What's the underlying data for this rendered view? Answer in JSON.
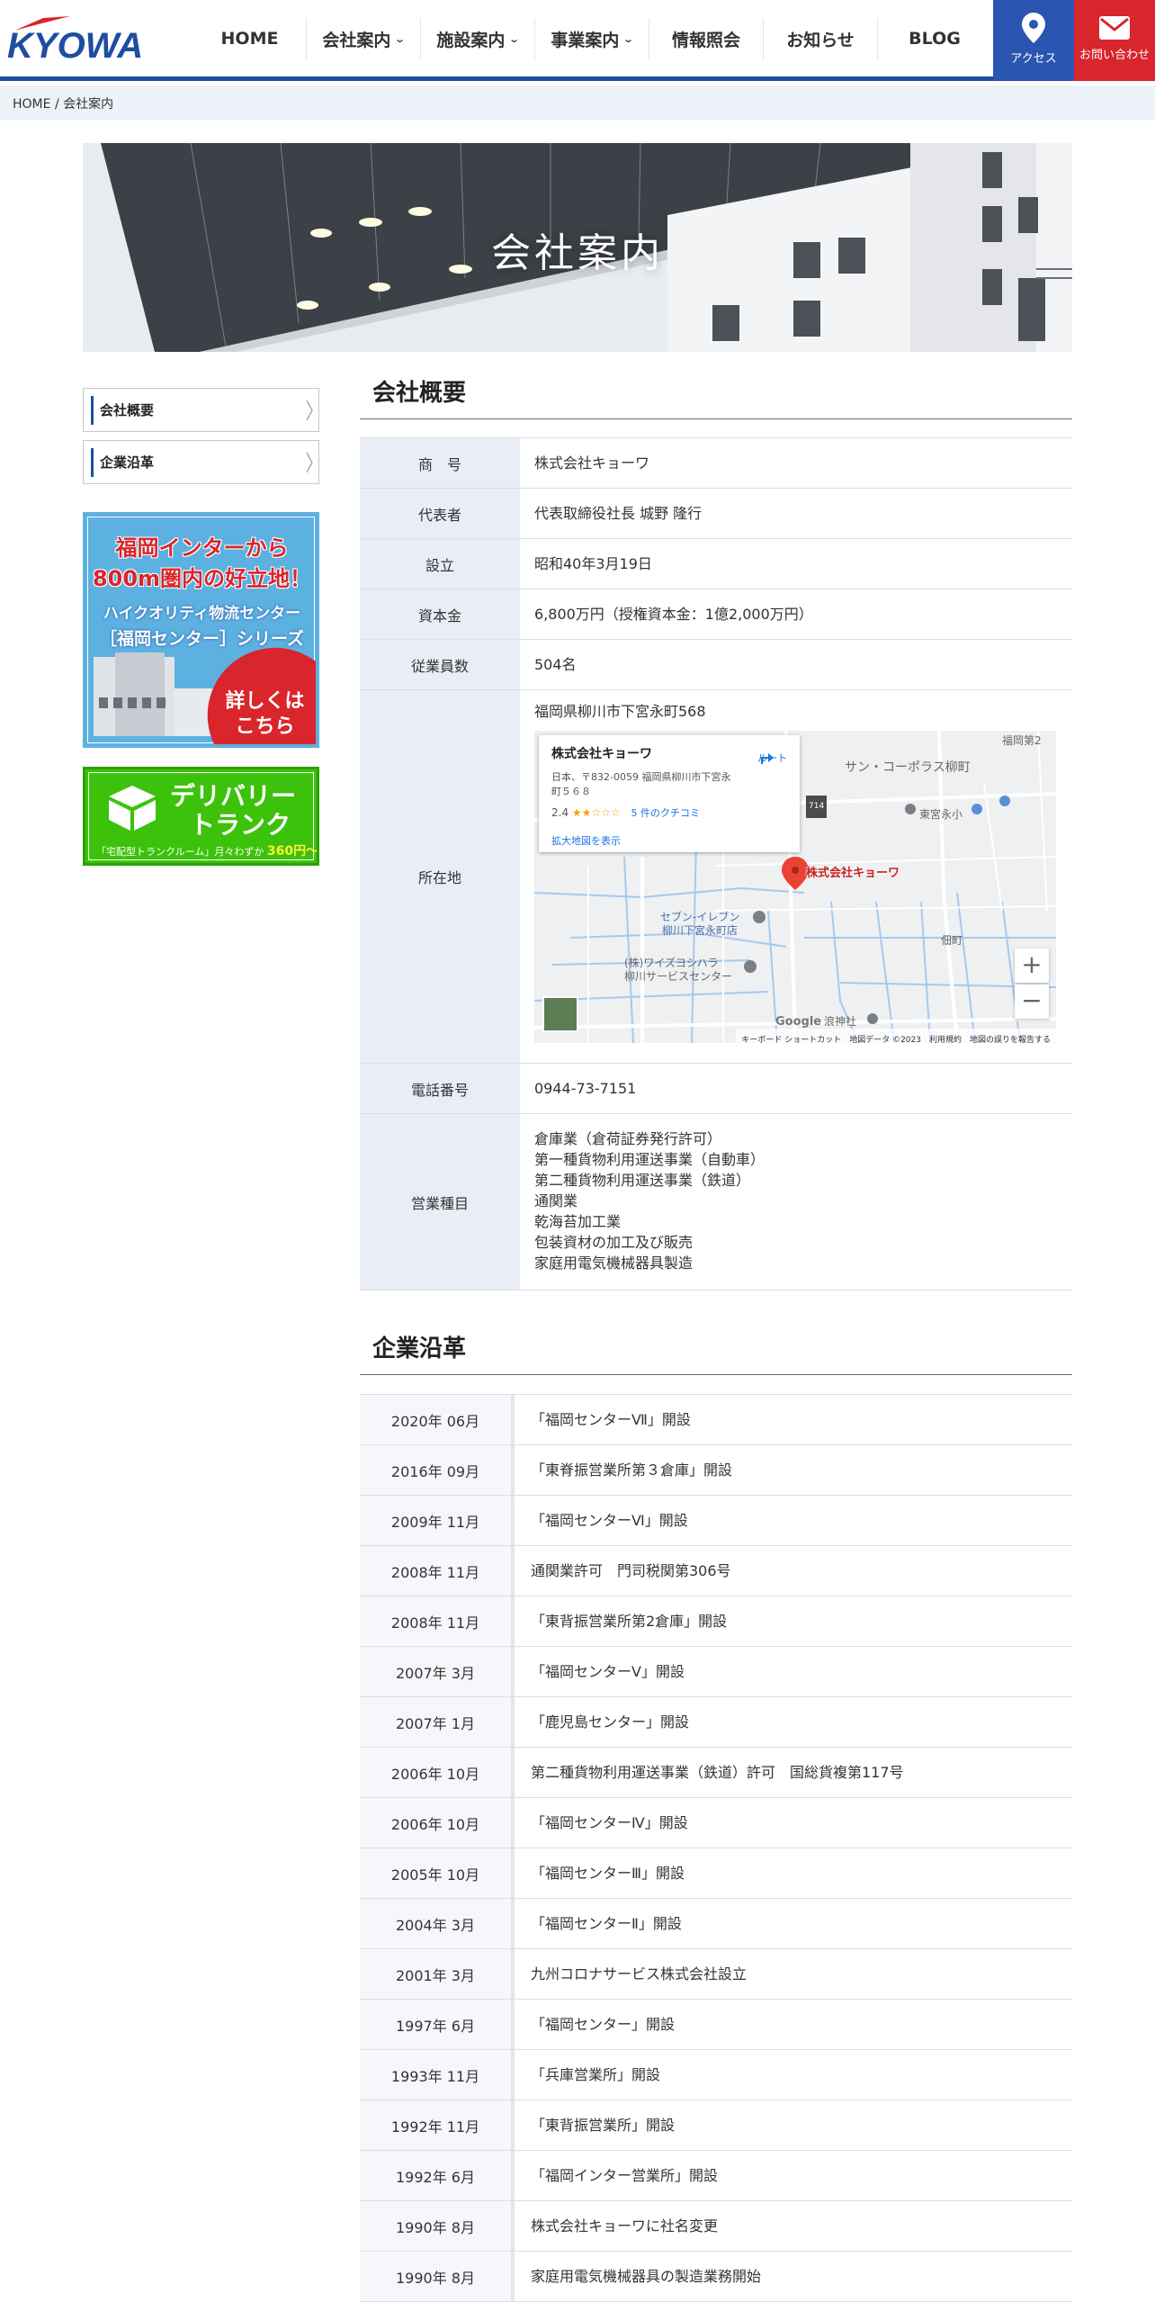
{
  "header": {
    "logo_text": "KYOWA",
    "nav": [
      {
        "label": "HOME",
        "has_dropdown": false
      },
      {
        "label": "会社案内",
        "has_dropdown": true
      },
      {
        "label": "施設案内",
        "has_dropdown": true
      },
      {
        "label": "事業案内",
        "has_dropdown": true
      },
      {
        "label": "情報照会",
        "has_dropdown": false
      },
      {
        "label": "お知らせ",
        "has_dropdown": false
      },
      {
        "label": "BLOG",
        "has_dropdown": false
      }
    ],
    "access_label": "アクセス",
    "contact_label": "お問い合わせ",
    "brand_color": "#1f4ea0",
    "accent_red": "#d9252c"
  },
  "breadcrumb": {
    "home": "HOME",
    "separator": "/",
    "current": "会社案内"
  },
  "hero": {
    "title": "会社案内"
  },
  "sidebar": {
    "links": [
      "会社概要",
      "企業沿革"
    ],
    "banner1": {
      "line1": "福岡インターから",
      "line2": "800m圏内の好立地！",
      "line3": "ハイクオリティ物流センター",
      "line4": "［福岡センター］シリーズ",
      "cta1": "詳しくは",
      "cta2": "こちら"
    },
    "banner2": {
      "line1": "デリバリー",
      "line2": "トランク",
      "sub": "「宅配型トランクルーム」月々わずか",
      "price": "360円〜！"
    }
  },
  "overview": {
    "title": "会社概要",
    "rows": [
      {
        "label": "商　号",
        "value": "株式会社キョーワ"
      },
      {
        "label": "代表者",
        "value": "代表取締役社長  城野 隆行"
      },
      {
        "label": "設立",
        "value": "昭和40年3月19日"
      },
      {
        "label": "資本金",
        "value": "6,800万円（授権資本金：1億2,000万円）"
      },
      {
        "label": "従業員数",
        "value": "504名"
      }
    ],
    "address": {
      "label": "所在地",
      "value": "福岡県柳川市下宮永町568"
    },
    "phone": {
      "label": "電話番号",
      "value": "0944-73-7151"
    },
    "business": {
      "label": "営業種目",
      "items": [
        "倉庫業（倉荷証券発行許可）",
        "第一種貨物利用運送事業（自動車）",
        "第二種貨物利用運送事業（鉄道）",
        "通関業",
        "乾海苔加工業",
        "包装資材の加工及び販売",
        "家庭用電気機械器具製造"
      ]
    }
  },
  "map": {
    "card_name": "株式会社キョーワ",
    "card_address": "日本、〒832-0059 福岡県柳川市下宮永町５６８",
    "rating": "2.4",
    "stars": "★★☆☆☆",
    "reviews": "5 件のクチコミ",
    "larger_map": "拡大地図を表示",
    "route": "ルート",
    "pin_label": "株式会社キョーワ",
    "labels": {
      "sun_corporas": "サン・コーポラス柳町",
      "higashimiyanaga": "東宮永小",
      "seven_eleven_1": "セブン-イレブン",
      "seven_eleven_2": "柳川下宮永町店",
      "wise_1": "(株)ワイズヨシハラ",
      "wise_2": "柳川サービスセンター",
      "tsukudamachi": "佃町",
      "shrine": "浪神社",
      "fukuoka_2": "福岡第2",
      "road": "714"
    },
    "zoom_in": "+",
    "zoom_out": "−",
    "google": "Google",
    "footer": "キーボード ショートカット　地図データ ©2023　利用規約　地図の誤りを報告する"
  },
  "history": {
    "title": "企業沿革",
    "rows": [
      {
        "date": "2020年 06月",
        "event": "「福岡センターⅦ」開設"
      },
      {
        "date": "2016年 09月",
        "event": "「東脊振営業所第３倉庫」開設"
      },
      {
        "date": "2009年 11月",
        "event": "「福岡センターⅥ」開設"
      },
      {
        "date": "2008年 11月",
        "event": "通関業許可　門司税関第306号"
      },
      {
        "date": "2008年 11月",
        "event": "「東背振営業所第2倉庫」開設"
      },
      {
        "date": "2007年 3月",
        "event": "「福岡センターV」開設"
      },
      {
        "date": "2007年 1月",
        "event": "「鹿児島センター」開設"
      },
      {
        "date": "2006年 10月",
        "event": "第二種貨物利用運送事業（鉄道）許可　国総貨複第117号"
      },
      {
        "date": "2006年 10月",
        "event": "「福岡センターⅣ」開設"
      },
      {
        "date": "2005年 10月",
        "event": "「福岡センターⅢ」開設"
      },
      {
        "date": "2004年 3月",
        "event": "「福岡センターⅡ」開設"
      },
      {
        "date": "2001年 3月",
        "event": "九州コロナサービス株式会社設立"
      },
      {
        "date": "1997年 6月",
        "event": "「福岡センター」開設"
      },
      {
        "date": "1993年 11月",
        "event": "「兵庫営業所」開設"
      },
      {
        "date": "1992年 11月",
        "event": "「東背振営業所」開設"
      },
      {
        "date": "1992年 6月",
        "event": "「福岡インター営業所」開設"
      },
      {
        "date": "1990年 8月",
        "event": "株式会社キョーワに社名変更"
      },
      {
        "date": "1990年 8月",
        "event": "家庭用電気機械器具の製造業務開始"
      }
    ]
  }
}
